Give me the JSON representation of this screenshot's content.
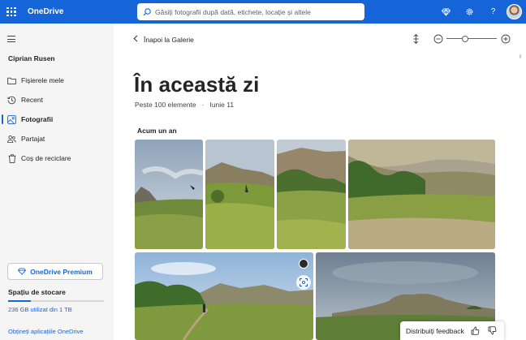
{
  "app": {
    "name": "OneDrive"
  },
  "search": {
    "placeholder": "Găsiți fotografii după dată, etichete, locație și altele"
  },
  "header_icons": [
    "waffle-icon",
    "diamond-icon",
    "gear-icon",
    "help-icon",
    "avatar"
  ],
  "header_help_glyph": "?",
  "sidebar": {
    "user_name": "Ciprian Rusen",
    "items": [
      {
        "label": "Fișierele mele",
        "icon": "folder-icon",
        "active": false
      },
      {
        "label": "Recent",
        "icon": "recent-icon",
        "active": false
      },
      {
        "label": "Fotografii",
        "icon": "photos-icon",
        "active": true
      },
      {
        "label": "Partajat",
        "icon": "people-icon",
        "active": false
      },
      {
        "label": "Coș de reciclare",
        "icon": "recycle-bin-icon",
        "active": false
      }
    ],
    "premium_label": "OneDrive Premium",
    "storage_title": "Spațiu de stocare",
    "storage_text": "236 GB utilizat din 1 TB",
    "storage_fraction": 0.236,
    "apps_link": "Obțineți aplicațiile OneDrive"
  },
  "main": {
    "back_label": "Înapoi la Galerie",
    "title": "În această zi",
    "item_count": "Peste 100 elemente",
    "date": "Iunie 11",
    "section_label": "Acum un an",
    "zoom_level": 0.35
  },
  "feedback": {
    "label": "Distribuiți feedback"
  },
  "colors": {
    "accent": "#1565d8",
    "sidebar_bg": "#f5f5f5"
  }
}
